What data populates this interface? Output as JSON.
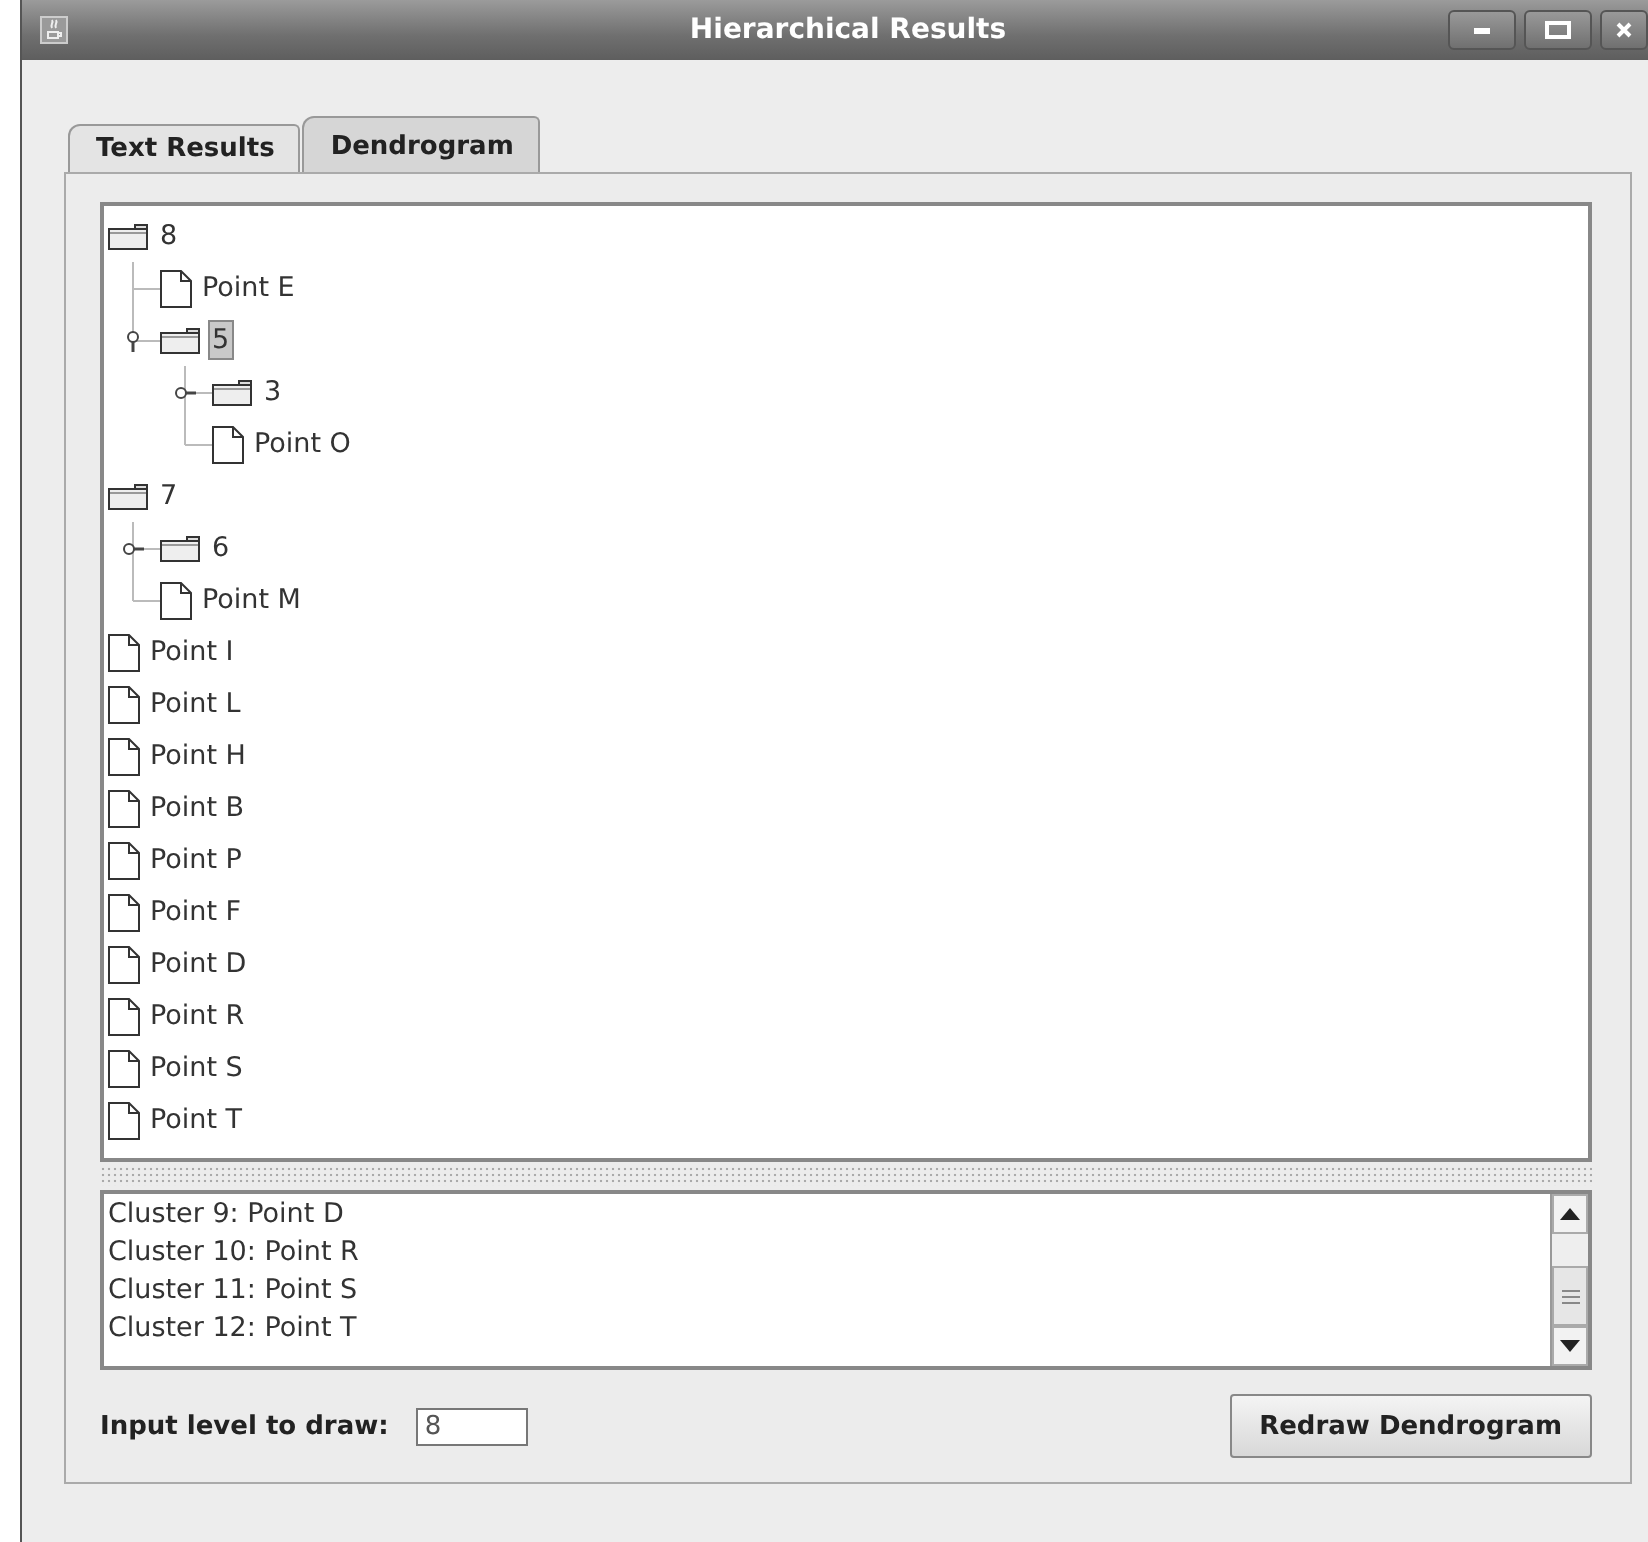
{
  "window": {
    "title": "Hierarchical Results"
  },
  "tabs": [
    {
      "label": "Text Results",
      "selected": false
    },
    {
      "label": "Dendrogram",
      "selected": true
    }
  ],
  "tree": [
    {
      "kind": "folder",
      "label": "8",
      "selected": false,
      "children": [
        {
          "kind": "leaf",
          "label": "Point E",
          "selected": false
        },
        {
          "kind": "folder",
          "label": "5",
          "expanded": true,
          "selected": true,
          "children": [
            {
              "kind": "folder",
              "label": "3",
              "expanded": false,
              "selected": false
            },
            {
              "kind": "leaf",
              "label": "Point O",
              "selected": false
            }
          ]
        }
      ]
    },
    {
      "kind": "folder",
      "label": "7",
      "selected": false,
      "children": [
        {
          "kind": "folder",
          "label": "6",
          "expanded": false,
          "selected": false
        },
        {
          "kind": "leaf",
          "label": "Point M",
          "selected": false
        }
      ]
    },
    {
      "kind": "leaf",
      "label": "Point I",
      "selected": false
    },
    {
      "kind": "leaf",
      "label": "Point L",
      "selected": false
    },
    {
      "kind": "leaf",
      "label": "Point H",
      "selected": false
    },
    {
      "kind": "leaf",
      "label": "Point B",
      "selected": false
    },
    {
      "kind": "leaf",
      "label": "Point P",
      "selected": false
    },
    {
      "kind": "leaf",
      "label": "Point F",
      "selected": false
    },
    {
      "kind": "leaf",
      "label": "Point D",
      "selected": false
    },
    {
      "kind": "leaf",
      "label": "Point R",
      "selected": false
    },
    {
      "kind": "leaf",
      "label": "Point S",
      "selected": false
    },
    {
      "kind": "leaf",
      "label": "Point T",
      "selected": false
    }
  ],
  "results_text": [
    "Cluster 9: Point D",
    "Cluster 10: Point R",
    "Cluster 11: Point S",
    "Cluster 12: Point T"
  ],
  "level_field": {
    "label": "Input level to draw:",
    "value": "8"
  },
  "redraw_button": "Redraw Dendrogram"
}
